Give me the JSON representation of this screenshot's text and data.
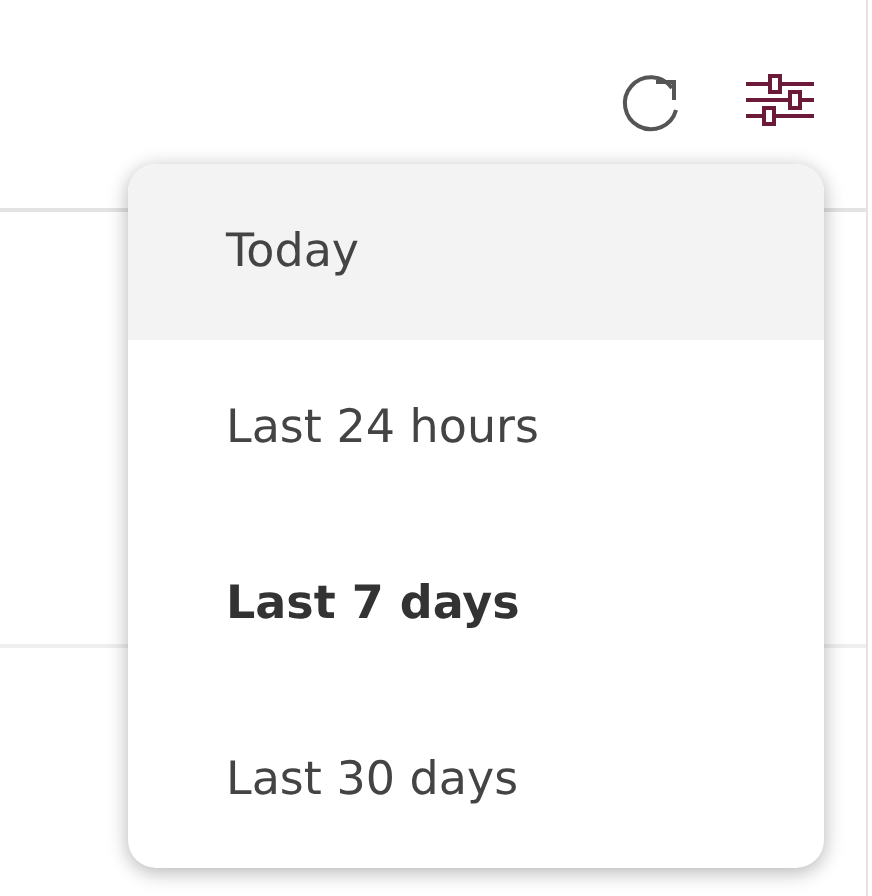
{
  "toolbar": {
    "icons": [
      {
        "kind": "refresh"
      },
      {
        "kind": "filters"
      }
    ]
  },
  "menu": {
    "items": [
      {
        "label": "Today",
        "selected": false,
        "hovered": true
      },
      {
        "label": "Last 24 hours",
        "selected": false,
        "hovered": false
      },
      {
        "label": "Last 7 days",
        "selected": true,
        "hovered": false
      },
      {
        "label": "Last 30 days",
        "selected": false,
        "hovered": false
      }
    ]
  }
}
